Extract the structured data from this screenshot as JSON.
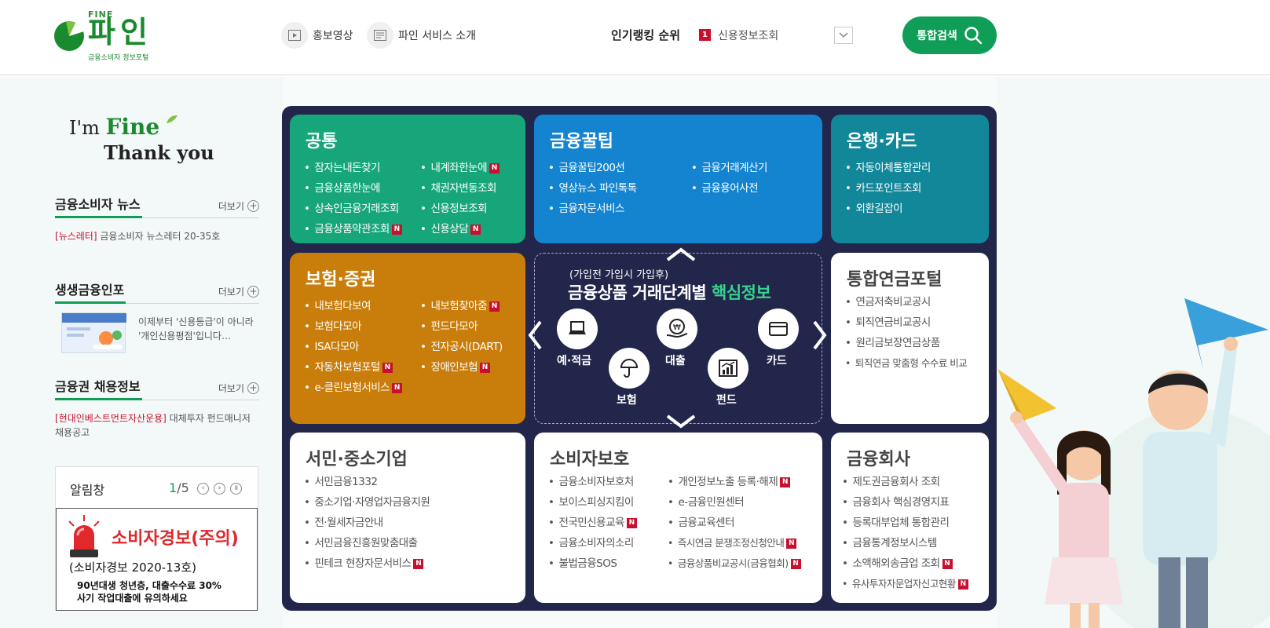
{
  "header": {
    "logo": {
      "fine": "FINE",
      "main": "파인",
      "sub": "금융소비자 정보포털"
    },
    "links": [
      {
        "label": "홍보영상",
        "icon": "play-icon"
      },
      {
        "label": "파인 서비스 소개",
        "icon": "screen-icon"
      }
    ],
    "ranking": {
      "label": "인기랭킹 순위",
      "rank": "1",
      "item": "신용정보조회"
    },
    "search_label": "통합검색"
  },
  "slogan": {
    "im": "I'm",
    "fine": "Fine",
    "thank": "Thank you"
  },
  "left": {
    "news": {
      "title": "금융소비자 뉴스",
      "more": "더보기",
      "tag": "[뉴스레터]",
      "text": "금융소비자 뉴스레터 20-35호"
    },
    "promo": {
      "title": "생생금융인포",
      "more": "더보기",
      "text": "이제부터 '신용등급'이 아니라 '개인신용평점'입니다…"
    },
    "jobs": {
      "title": "금융권 채용정보",
      "more": "더보기",
      "tag": "[현대인베스트먼트자산운용]",
      "text": "대체투자 펀드매니저 채용공고"
    },
    "alarm": {
      "title": "알림창",
      "current": "1",
      "total": "/5",
      "warn": "소비자경보(주의)",
      "no": "(소비자경보 2020-13호)",
      "desc1": "90년대생 청년층, 대출수수료 30%",
      "desc2": "사기 작업대출에 유의하세요"
    }
  },
  "cards": {
    "common": {
      "title": "공통",
      "left": [
        "잠자는내돈찾기",
        "금융상품한눈에",
        "상속인금융거래조회",
        "금융상품약관조회"
      ],
      "right": [
        "내계좌한눈에",
        "채권자변동조회",
        "신용정보조회",
        "신용상담"
      ]
    },
    "tips": {
      "title": "금융꿀팁",
      "left": [
        "금융꿀팁200선",
        "영상뉴스 파인톡톡",
        "금융자문서비스"
      ],
      "right": [
        "금융거래계산기",
        "금융용어사전"
      ]
    },
    "bank": {
      "title": "은행·카드",
      "items": [
        "자동이체통합관리",
        "카드포인트조회",
        "외환길잡이"
      ]
    },
    "insurance": {
      "title": "보험·증권",
      "left": [
        "내보험다보여",
        "보험다모아",
        "ISA다모아",
        "자동차보험포털",
        "e-클린보험서비스"
      ],
      "right": [
        "내보험찾아줌",
        "펀드다모아",
        "전자공시(DART)",
        "장애인보험"
      ]
    },
    "center": {
      "sub": "(가입전 가입시 가입후)",
      "title": "금융상품 거래단계별",
      "title_hl": "핵심정보",
      "items": [
        "예·적금",
        "대출",
        "카드",
        "보험",
        "펀드"
      ]
    },
    "pension": {
      "title": "통합연금포털",
      "items": [
        "연금저축비교공시",
        "퇴직연금비교공시",
        "원리금보장연금상품",
        "퇴직연금 맞춤형 수수료 비교"
      ]
    },
    "seomin": {
      "title": "서민·중소기업",
      "items": [
        "서민금융1332",
        "중소기업·자영업자금융지원",
        "전·월세자금안내",
        "서민금융진흥원맞춤대출",
        "핀테크 현장자문서비스"
      ]
    },
    "consumer": {
      "title": "소비자보호",
      "left": [
        "금융소비자보호처",
        "보이스피싱지킴이",
        "전국민신용교육",
        "금융소비자의소리",
        "불법금융SOS"
      ],
      "right": [
        "개인정보노출 등록·해제",
        "e-금융민원센터",
        "금융교육센터",
        "즉시연금 분쟁조정신청안내",
        "금융상품비교공시(금융협회)"
      ]
    },
    "company": {
      "title": "금융회사",
      "items": [
        "제도권금융회사 조회",
        "금융회사 핵심경영지표",
        "등록대부업체 통합관리",
        "금융통계정보시스템",
        "소액해외송금업 조회",
        "유사투자자문업자신고현황"
      ]
    }
  },
  "badge_n": "N"
}
